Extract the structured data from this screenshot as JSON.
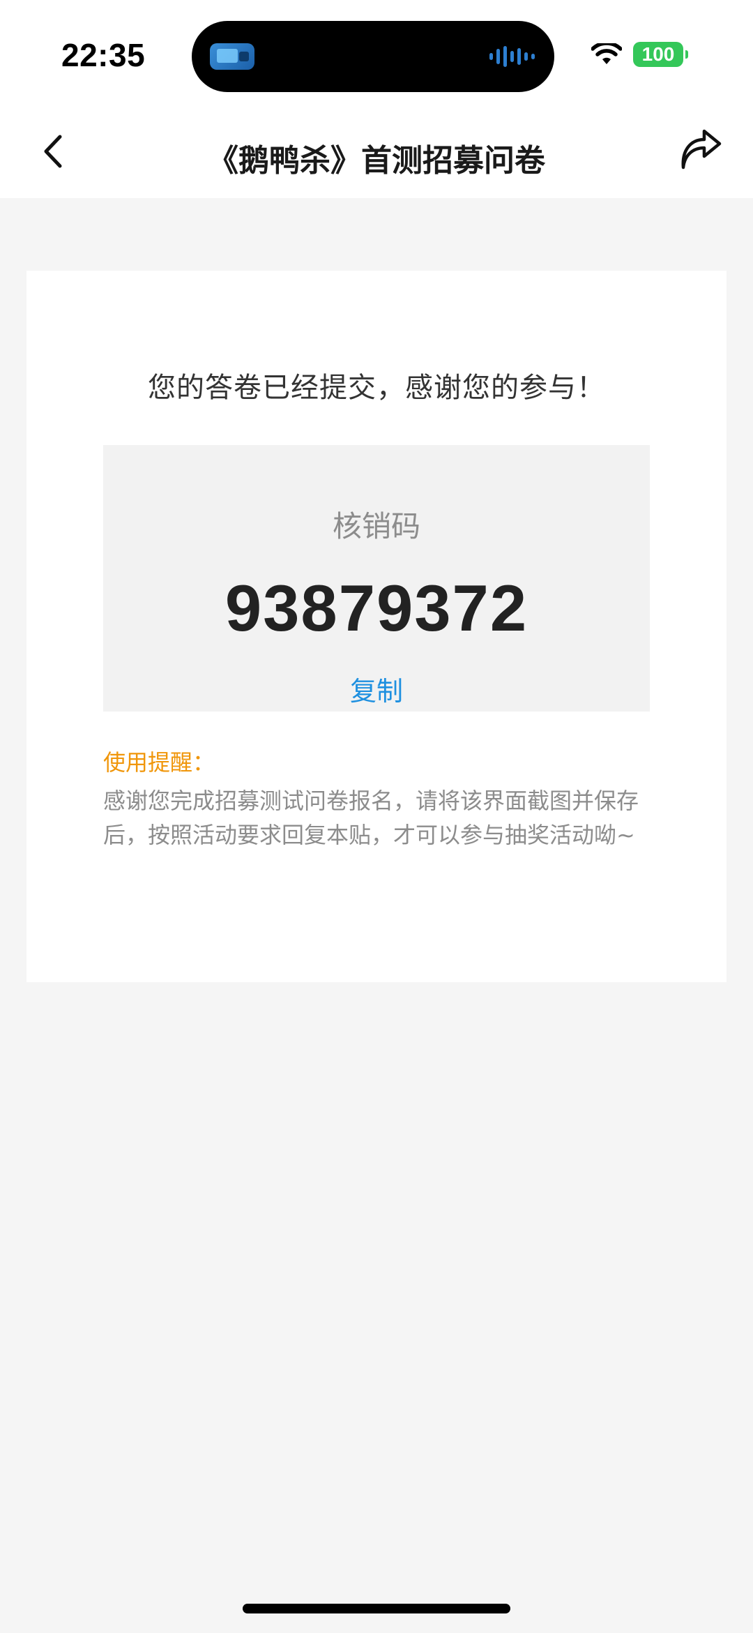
{
  "status_bar": {
    "time": "22:35",
    "battery": "100"
  },
  "nav": {
    "title": "《鹅鸭杀》首测招募问卷",
    "back_icon": "chevron-left-icon",
    "share_icon": "share-arrow-icon"
  },
  "result": {
    "thanks_message": "您的答卷已经提交，感谢您的参与！",
    "code_label": "核销码",
    "code_value": "93879372",
    "copy_label": "复制",
    "reminder_title": "使用提醒：",
    "reminder_body": "感谢您完成招募测试问卷报名，请将该界面截图并保存后，按照活动要求回复本贴，才可以参与抽奖活动呦~"
  },
  "colors": {
    "background": "#f5f5f5",
    "card": "#ffffff",
    "code_box": "#f2f2f2",
    "link_blue": "#1e90e0",
    "reminder_orange": "#f0960a",
    "battery_green": "#34c759"
  }
}
